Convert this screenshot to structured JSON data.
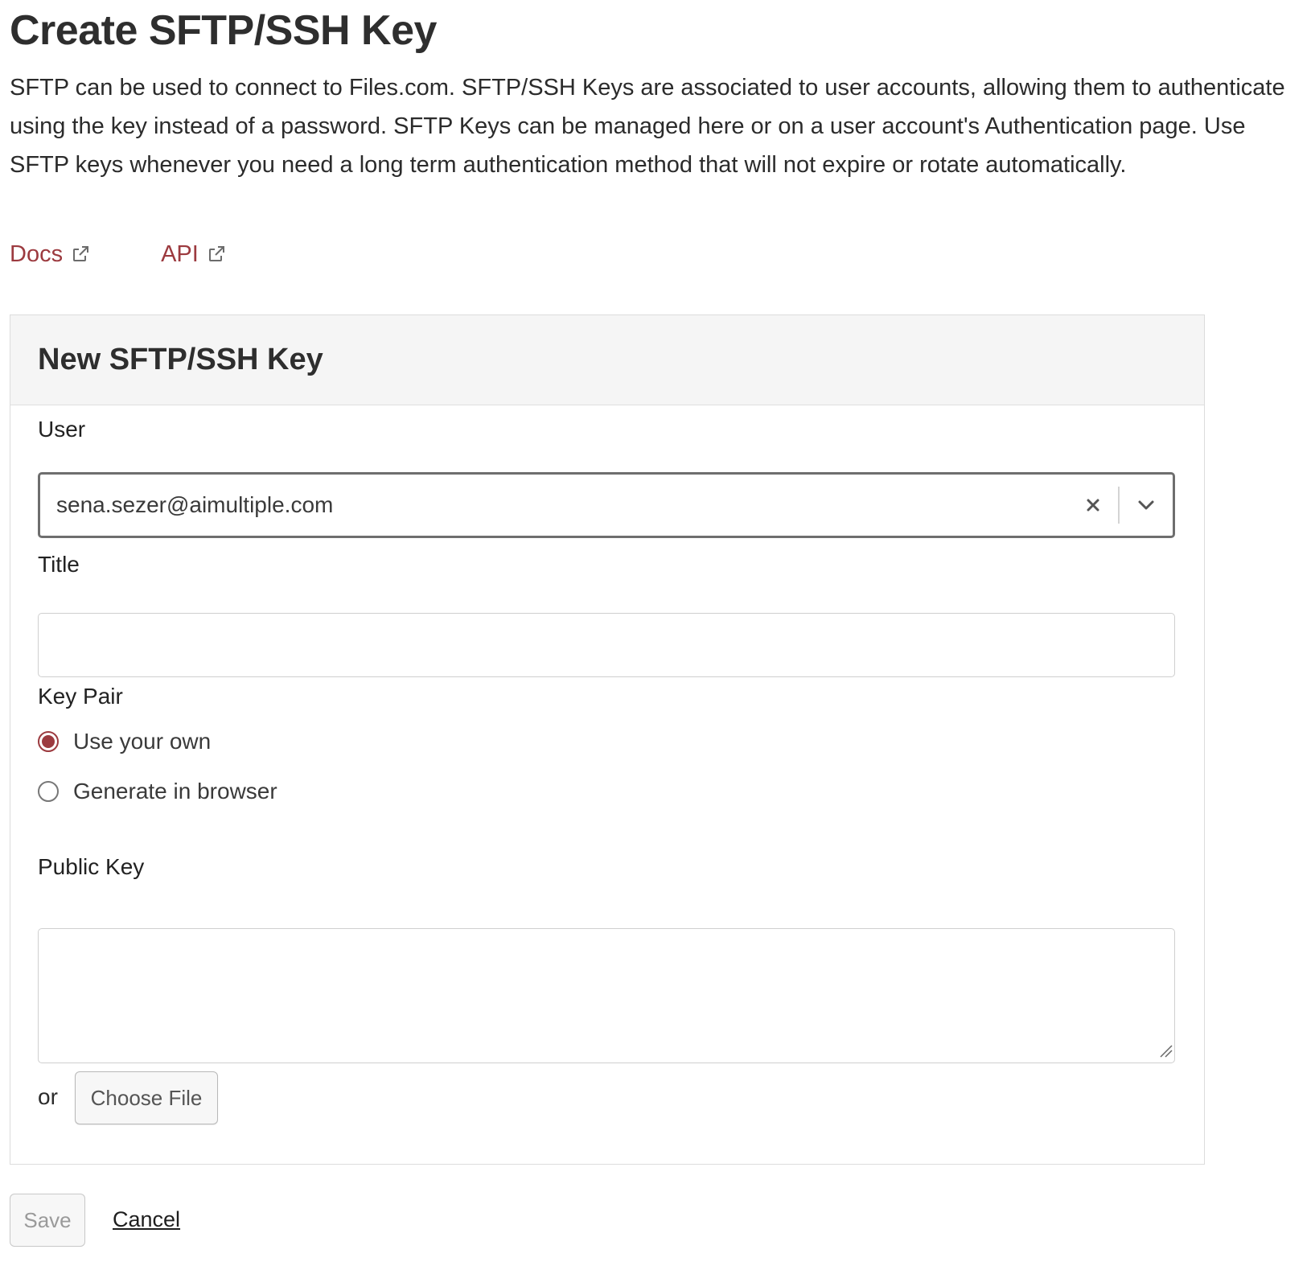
{
  "page": {
    "title": "Create SFTP/SSH Key",
    "description": "SFTP can be used to connect to Files.com. SFTP/SSH Keys are associated to user accounts, allowing them to authenticate using the key instead of a password. SFTP Keys can be managed here or on a user account's Authentication page. Use SFTP keys whenever you need a long term authentication method that will not expire or rotate automatically."
  },
  "links": {
    "docs_label": "Docs",
    "api_label": "API"
  },
  "form": {
    "card_title": "New SFTP/SSH Key",
    "user": {
      "label": "User",
      "value": "sena.sezer@aimultiple.com"
    },
    "title_field": {
      "label": "Title",
      "value": ""
    },
    "key_pair": {
      "label": "Key Pair",
      "options": [
        {
          "label": "Use your own",
          "selected": true
        },
        {
          "label": "Generate in browser",
          "selected": false
        }
      ]
    },
    "public_key": {
      "label": "Public Key",
      "value": ""
    },
    "or_text": "or",
    "choose_file_label": "Choose File"
  },
  "actions": {
    "save_label": "Save",
    "cancel_label": "Cancel"
  },
  "colors": {
    "accent": "#9c3a3f",
    "text": "#2b2b2b",
    "header_bg": "#f5f5f5"
  }
}
